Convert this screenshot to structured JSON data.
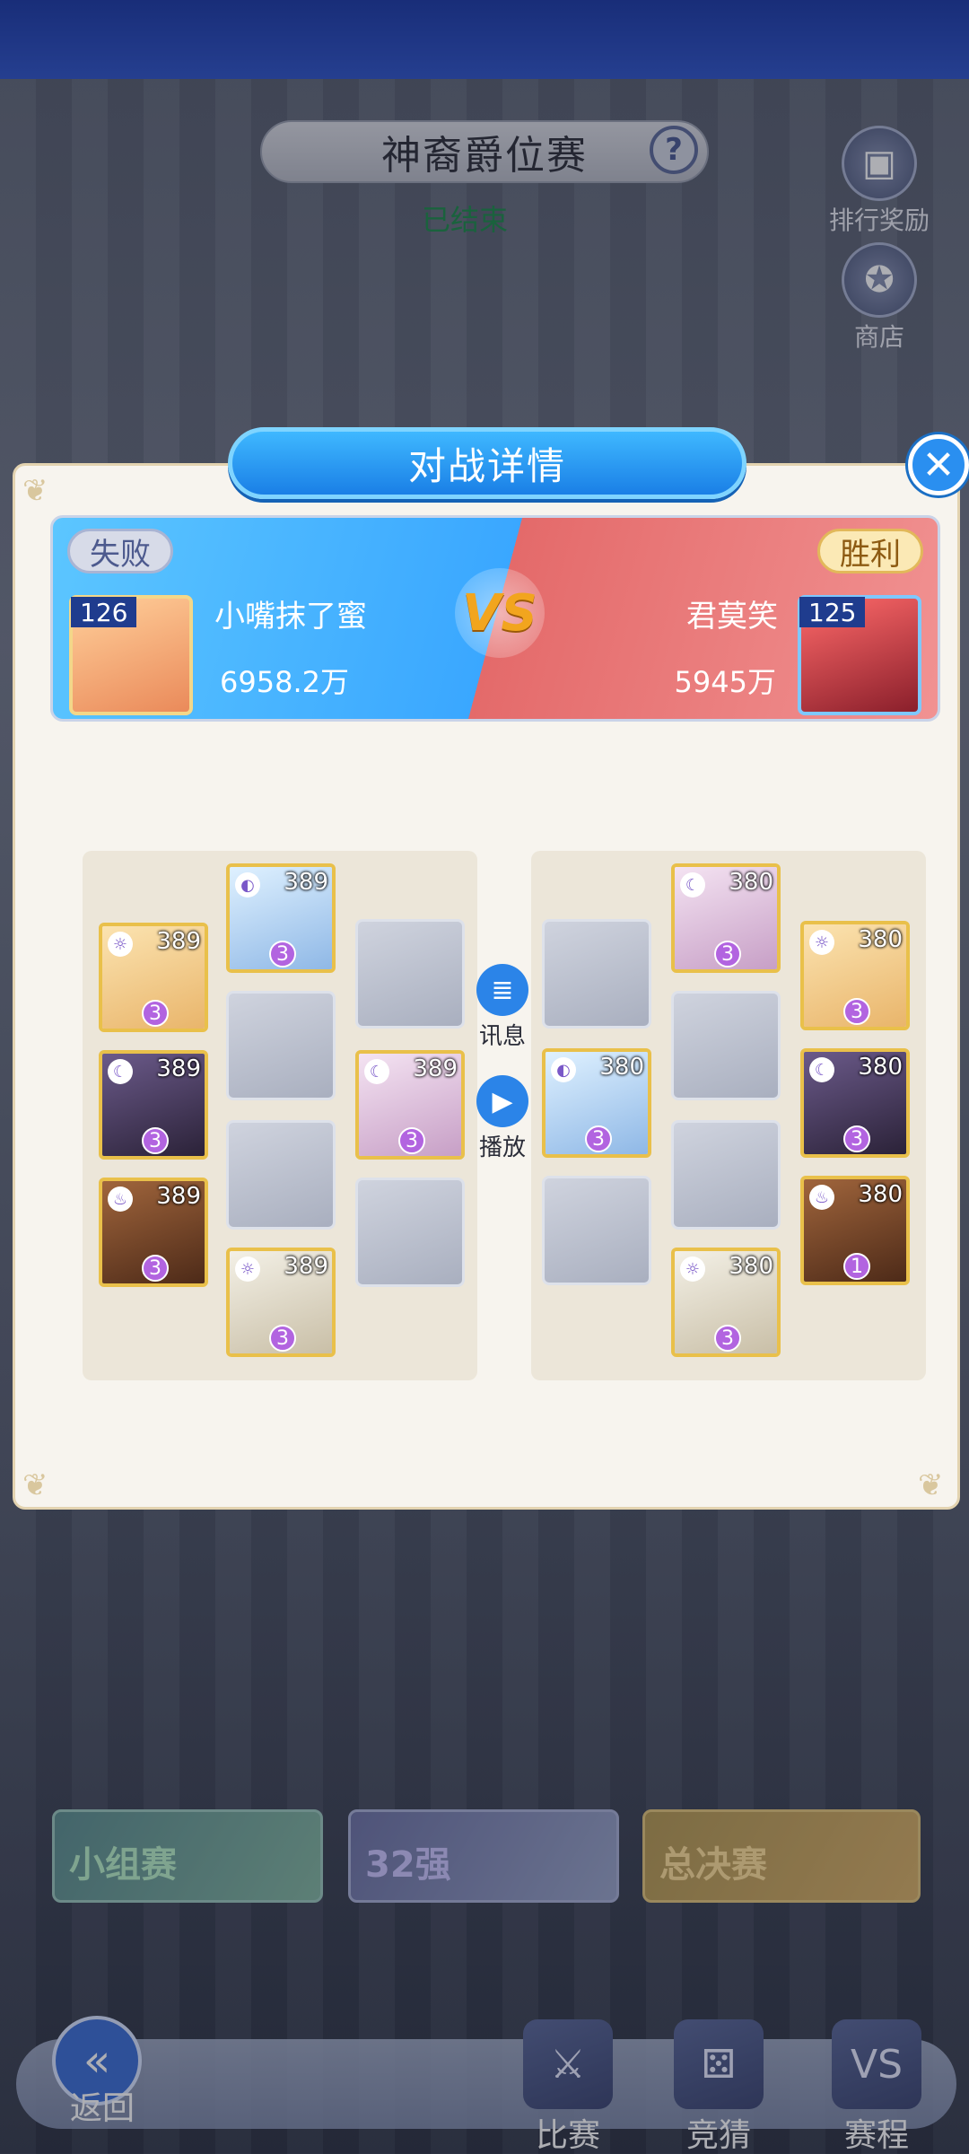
{
  "page": {
    "title": "神裔爵位赛",
    "status": "已结束"
  },
  "side_buttons": [
    {
      "label": "排行奖励",
      "icon": "trophy-card-icon"
    },
    {
      "label": "商店",
      "icon": "shop-icon"
    }
  ],
  "modal": {
    "title": "对战详情",
    "left": {
      "result": "失败",
      "level": "126",
      "name": "小嘴抹了蜜",
      "power": "6958.2万"
    },
    "right": {
      "result": "胜利",
      "level": "125",
      "name": "君莫笑",
      "power": "5945万"
    },
    "vs": "VS",
    "left_heroes": [
      {
        "level": "389",
        "star": "3"
      },
      {
        "level": "389",
        "star": "3"
      },
      {
        "level": "389",
        "star": "3"
      },
      {
        "level": "389",
        "star": "3"
      },
      {
        "level": "389",
        "star": "3"
      },
      {
        "level": "389",
        "star": "3"
      }
    ],
    "right_heroes": [
      {
        "level": "380",
        "star": "3"
      },
      {
        "level": "380",
        "star": "3"
      },
      {
        "level": "380",
        "star": "3"
      },
      {
        "level": "380",
        "star": "3"
      },
      {
        "level": "380",
        "star": "3"
      },
      {
        "level": "380",
        "star": "1"
      }
    ],
    "actions": {
      "info": "讯息",
      "replay": "播放"
    }
  },
  "stages": [
    {
      "label": "小组赛"
    },
    {
      "label": "32强"
    },
    {
      "label": "总决赛"
    }
  ],
  "nav": {
    "back": "返回",
    "match": "比赛",
    "guess": "竞猜",
    "schedule": "赛程"
  },
  "colors": {
    "accent_blue": "#2a8ff0",
    "win_red": "#e46a6a",
    "lose_blue": "#3aa7ff",
    "status_green": "#1e8a4b"
  }
}
